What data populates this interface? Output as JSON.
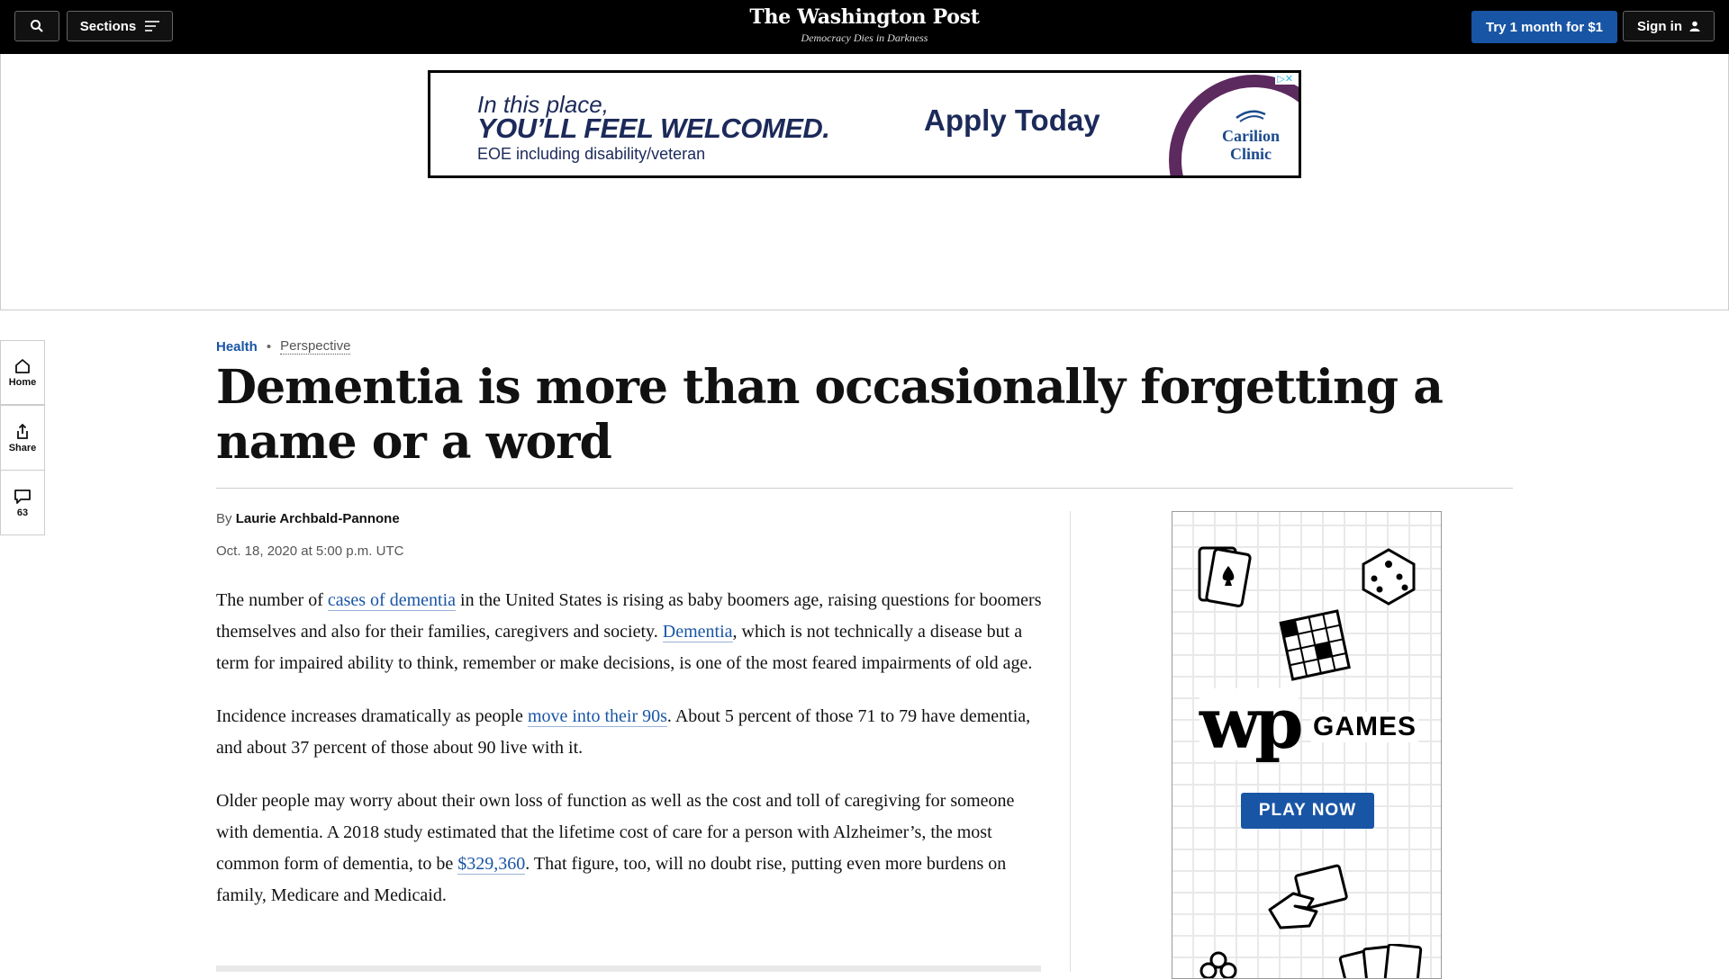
{
  "header": {
    "sections_label": "Sections",
    "logo_text": "The Washington Post",
    "tagline": "Democracy Dies in Darkness",
    "trial_label": "Try 1 month for $1",
    "signin_label": "Sign in"
  },
  "banner_ad": {
    "line1": "In this place,",
    "line2": "YOU’LL FEEL WELCOMED.",
    "line3": "EOE including disability/veteran",
    "cta": "Apply Today",
    "brand_line1": "Carilion",
    "brand_line2": "Clinic",
    "ad_marker": "▷✕"
  },
  "rail": {
    "home_label": "Home",
    "share_label": "Share",
    "comments_count": "63"
  },
  "article": {
    "section": "Health",
    "label": "Perspective",
    "headline": "Dementia is more than occasionally forgetting a name or a word",
    "by": "By",
    "author": "Laurie Archbald-Pannone",
    "date": "Oct. 18, 2020 at 5:00 p.m. UTC",
    "p1": {
      "t1": "The number of ",
      "link1": "cases of dementia",
      "t2": " in the United States is rising as baby boomers age, raising questions for boomers themselves and also for their families, caregivers and society. ",
      "link2": "Dementia",
      "t3": ", which is not technically a disease but a term for impaired ability to think, remember or make decisions, is one of the most feared impairments of old age."
    },
    "p2": {
      "t1": "Incidence increases dramatically as people ",
      "link1": "move into their 90s",
      "t2": ". About 5 percent of those 71 to 79 have dementia, and about 37 percent of those about 90 live with it."
    },
    "p3": {
      "t1": "Older people may worry about their own loss of function as well as the cost and toll of caregiving for someone with dementia. A 2018 study estimated that the lifetime cost of care for a person with Alzheimer’s, the most common form of dementia, to be ",
      "link1": "$329,360",
      "t2": ". That figure, too, will no doubt rise, putting even more burdens on family, Medicare and Medicaid."
    }
  },
  "games_ad": {
    "logo": "wp",
    "word": "GAMES",
    "cta": "PLAY NOW"
  },
  "colors": {
    "brand_blue": "#1955a5",
    "topbar": "#000000"
  }
}
